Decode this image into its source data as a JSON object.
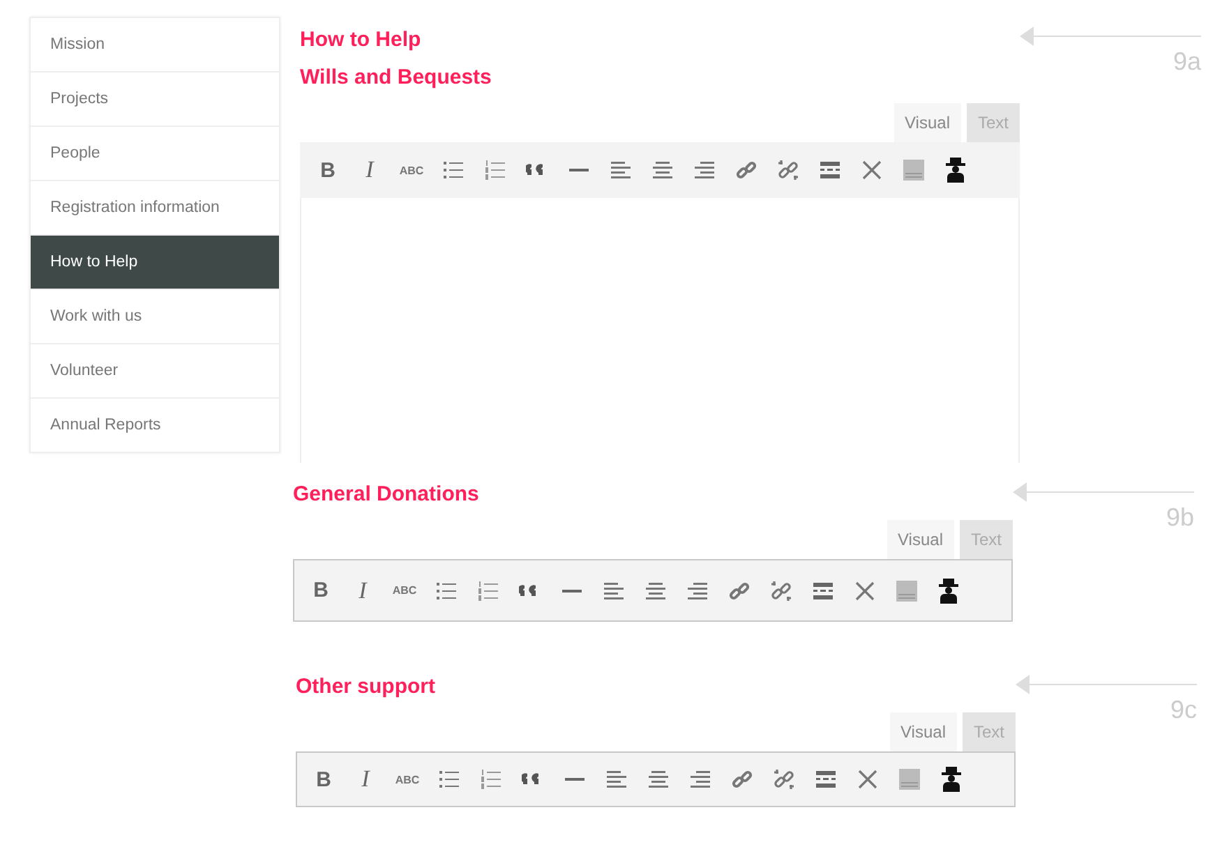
{
  "sidebar": {
    "items": [
      {
        "label": "Mission",
        "selected": false
      },
      {
        "label": "Projects",
        "selected": false
      },
      {
        "label": "People",
        "selected": false
      },
      {
        "label": "Registration information",
        "selected": false
      },
      {
        "label": "How to Help",
        "selected": true
      },
      {
        "label": "Work with us",
        "selected": false
      },
      {
        "label": "Volunteer",
        "selected": false
      },
      {
        "label": "Annual Reports",
        "selected": false
      }
    ]
  },
  "sections": [
    {
      "headings": [
        "How to Help",
        "Wills and Bequests"
      ],
      "marker": "9a",
      "editor": {
        "tabs": [
          {
            "label": "Visual",
            "selected": true
          },
          {
            "label": "Text",
            "selected": false
          }
        ],
        "has_body": true,
        "toolbar": [
          {
            "kind": "bold",
            "label": "B"
          },
          {
            "kind": "italic",
            "label": "I"
          },
          {
            "kind": "strike",
            "label": "ABC"
          },
          {
            "kind": "bullets"
          },
          {
            "kind": "numbers"
          },
          {
            "kind": "quote"
          },
          {
            "kind": "rule"
          },
          {
            "kind": "align-left"
          },
          {
            "kind": "align-center"
          },
          {
            "kind": "align-right"
          },
          {
            "kind": "link"
          },
          {
            "kind": "unlink"
          },
          {
            "kind": "more"
          },
          {
            "kind": "fullscreen"
          },
          {
            "kind": "sink"
          },
          {
            "kind": "figure"
          }
        ]
      }
    },
    {
      "headings": [
        "General Donations"
      ],
      "marker": "9b",
      "editor": {
        "tabs": [
          {
            "label": "Visual",
            "selected": true
          },
          {
            "label": "Text",
            "selected": false
          }
        ],
        "has_body": false,
        "toolbar": [
          {
            "kind": "bold",
            "label": "B"
          },
          {
            "kind": "italic",
            "label": "I"
          },
          {
            "kind": "strike",
            "label": "ABC"
          },
          {
            "kind": "bullets"
          },
          {
            "kind": "numbers"
          },
          {
            "kind": "quote"
          },
          {
            "kind": "rule"
          },
          {
            "kind": "align-left"
          },
          {
            "kind": "align-center"
          },
          {
            "kind": "align-right"
          },
          {
            "kind": "link"
          },
          {
            "kind": "unlink"
          },
          {
            "kind": "more"
          },
          {
            "kind": "fullscreen"
          },
          {
            "kind": "sink"
          },
          {
            "kind": "figure"
          }
        ]
      }
    },
    {
      "headings": [
        "Other support"
      ],
      "marker": "9c",
      "editor": {
        "tabs": [
          {
            "label": "Visual",
            "selected": true
          },
          {
            "label": "Text",
            "selected": false
          }
        ],
        "has_body": false,
        "toolbar": [
          {
            "kind": "bold",
            "label": "B"
          },
          {
            "kind": "italic",
            "label": "I"
          },
          {
            "kind": "strike",
            "label": "ABC"
          },
          {
            "kind": "bullets"
          },
          {
            "kind": "numbers"
          },
          {
            "kind": "quote"
          },
          {
            "kind": "rule"
          },
          {
            "kind": "align-left"
          },
          {
            "kind": "align-center"
          },
          {
            "kind": "align-right"
          },
          {
            "kind": "link"
          },
          {
            "kind": "unlink"
          },
          {
            "kind": "more"
          },
          {
            "kind": "fullscreen"
          },
          {
            "kind": "sink"
          },
          {
            "kind": "figure"
          }
        ]
      }
    }
  ]
}
